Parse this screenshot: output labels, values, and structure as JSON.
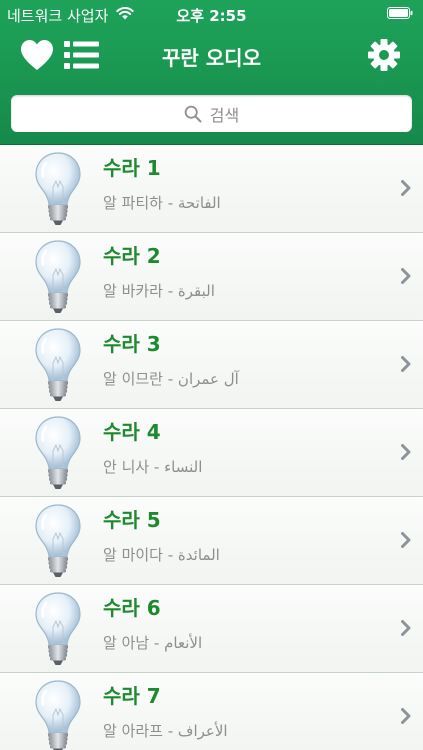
{
  "status": {
    "carrier": "네트워크 사업자",
    "time": "오후 2:55"
  },
  "nav": {
    "title": "꾸란 오디오"
  },
  "search": {
    "placeholder": "검색"
  },
  "surahs": [
    {
      "title": "수라 1",
      "subtitle": "알 파티하 - الفاتحة"
    },
    {
      "title": "수라 2",
      "subtitle": "알 바카라 - البقرة"
    },
    {
      "title": "수라 3",
      "subtitle": "알 이므란 - آل عمران"
    },
    {
      "title": "수라 4",
      "subtitle": "안 니사 - النساء"
    },
    {
      "title": "수라 5",
      "subtitle": "알 마이다 - المائدة"
    },
    {
      "title": "수라 6",
      "subtitle": "알 아남 - الأنعام"
    },
    {
      "title": "수라 7",
      "subtitle": "알 아라프 - الأعراف"
    }
  ],
  "icons": {
    "favorites": "heart-icon",
    "list": "list-icon",
    "settings": "gear-icon",
    "search": "search-icon",
    "row": "lightbulb-icon",
    "disclosure": "chevron-right-icon"
  },
  "colors": {
    "header": "#1b9a53",
    "row_title": "#1e8a2e",
    "row_subtitle": "#8e8e8e"
  }
}
